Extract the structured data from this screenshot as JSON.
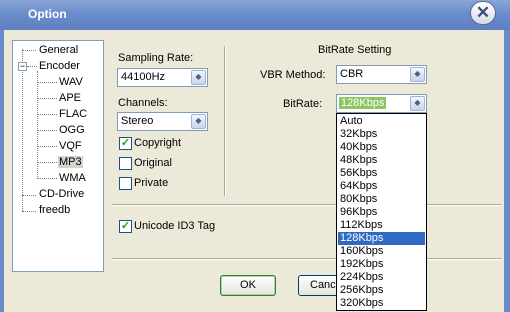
{
  "window": {
    "title": "Option"
  },
  "tree": {
    "items": [
      {
        "label": "General"
      },
      {
        "label": "Encoder",
        "expander": "−"
      },
      {
        "label": "WAV"
      },
      {
        "label": "APE"
      },
      {
        "label": "FLAC"
      },
      {
        "label": "OGG"
      },
      {
        "label": "VQF"
      },
      {
        "label": "MP3",
        "selected": true
      },
      {
        "label": "WMA"
      },
      {
        "label": "CD-Drive"
      },
      {
        "label": "freedb"
      }
    ]
  },
  "encoder": {
    "sampling_rate_label": "Sampling Rate:",
    "sampling_rate_value": "44100Hz",
    "channels_label": "Channels:",
    "channels_value": "Stereo",
    "copyright_label": "Copyright",
    "copyright_checked": true,
    "original_label": "Original",
    "original_checked": false,
    "private_label": "Private",
    "private_checked": false,
    "unicode_label": "Unicode ID3 Tag",
    "unicode_checked": true
  },
  "bitrate_setting": {
    "heading": "BitRate Setting",
    "vbr_label": "VBR Method:",
    "vbr_value": "CBR",
    "bitrate_label": "BitRate:",
    "bitrate_value": "128Kbps"
  },
  "dropdown": {
    "options": [
      "Auto",
      "32Kbps",
      "40Kbps",
      "48Kbps",
      "56Kbps",
      "64Kbps",
      "80Kbps",
      "96Kbps",
      "112Kbps",
      "128Kbps",
      "160Kbps",
      "192Kbps",
      "224Kbps",
      "256Kbps",
      "320Kbps"
    ],
    "selected": "128Kbps"
  },
  "buttons": {
    "ok": "OK",
    "cancel": "Cance"
  },
  "icons": {
    "close": "close-icon",
    "arrow": "chevron-down-icon"
  },
  "colors": {
    "titlebar": "#6b8ccb",
    "selection": "#316ac5",
    "bitrate_highlight": "#8cc662"
  }
}
